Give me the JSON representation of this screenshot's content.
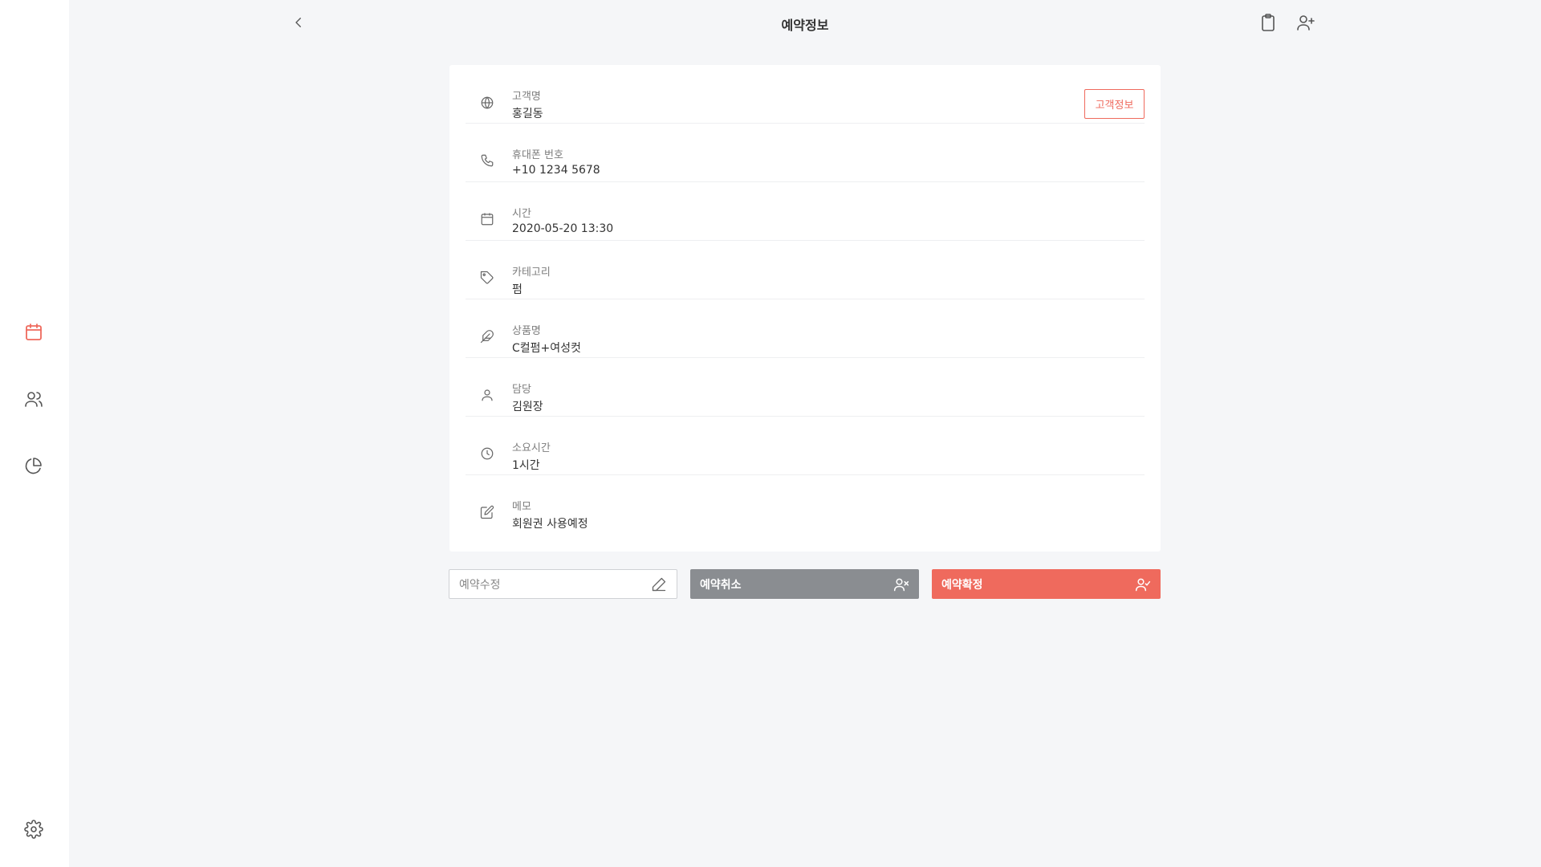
{
  "page": {
    "title": "예약정보"
  },
  "sidebar": {
    "items": [
      {
        "icon": "calendar-icon",
        "active": true
      },
      {
        "icon": "users-icon",
        "active": false
      },
      {
        "icon": "pie-chart-icon",
        "active": false
      }
    ],
    "settings_icon": "gear-icon"
  },
  "topbar": {
    "back_icon": "chevron-left-icon",
    "actions": [
      "clipboard-icon",
      "user-plus-icon"
    ]
  },
  "details": [
    {
      "icon": "globe-icon",
      "label": "고객명",
      "value": "홍길동"
    },
    {
      "icon": "phone-icon",
      "label": "휴대폰 번호",
      "value": "+10 1234 5678"
    },
    {
      "icon": "calendar-icon",
      "label": "시간",
      "value": "2020-05-20 13:30"
    },
    {
      "icon": "tag-icon",
      "label": "카테고리",
      "value": "펌"
    },
    {
      "icon": "feather-icon",
      "label": "상품명",
      "value": "C컬펌+여성컷"
    },
    {
      "icon": "user-icon",
      "label": "담당",
      "value": "김원장"
    },
    {
      "icon": "clock-icon",
      "label": "소요시간",
      "value": "1시간"
    },
    {
      "icon": "edit-icon",
      "label": "메모",
      "value": "회원권 사용예정"
    }
  ],
  "customer_info_button": "고객정보",
  "actions": {
    "edit": "예약수정",
    "cancel": "예약취소",
    "confirm": "예약확정"
  },
  "colors": {
    "accent": "#ef6a5d",
    "gray_button": "#8a8d91",
    "background": "#f5f6f8"
  }
}
